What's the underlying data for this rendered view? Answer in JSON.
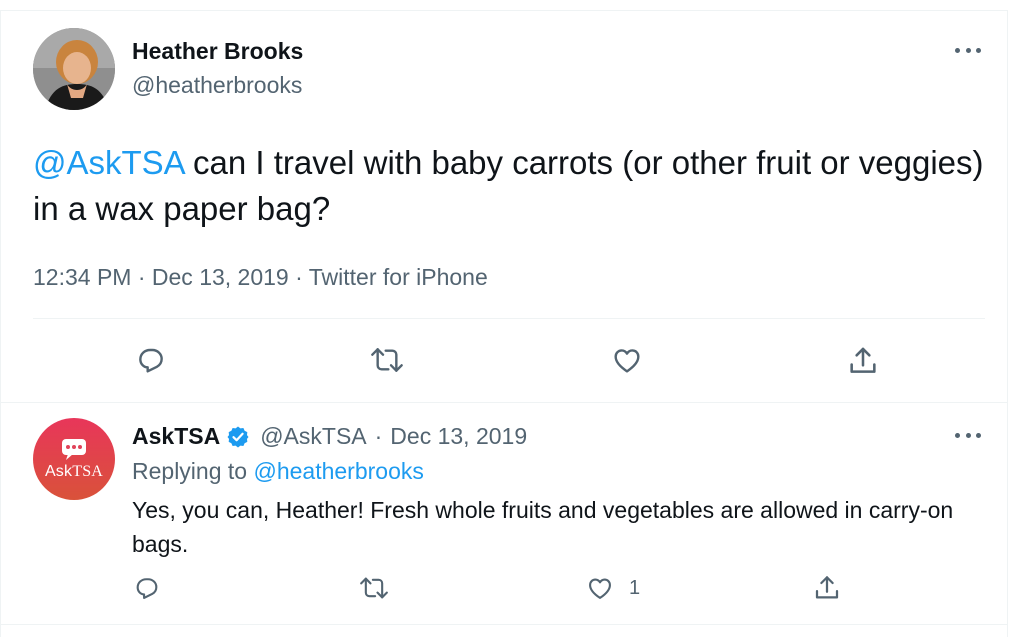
{
  "tweet": {
    "author_name": "Heather Brooks",
    "author_handle": "@heatherbrooks",
    "mention": "@AskTSA",
    "text": " can I travel with baby carrots (or other fruit or veggies) in a wax paper bag?",
    "time": "12:34 PM",
    "date": "Dec 13, 2019",
    "source": "Twitter for iPhone",
    "separator": "·"
  },
  "reply": {
    "author_name": "AskTSA",
    "author_handle": "@AskTSA",
    "separator": "·",
    "date": "Dec 13, 2019",
    "replying_label": "Replying to",
    "replying_to": "@heatherbrooks",
    "text": "Yes, you can, Heather! Fresh whole fruits and vegetables are allowed in carry-on bags.",
    "like_count": "1",
    "avatar_text_a": "Ask",
    "avatar_text_b": "TSA"
  },
  "icons": {
    "reply": "reply-icon",
    "retweet": "retweet-icon",
    "like": "heart-icon",
    "share": "share-icon",
    "more": "more-icon",
    "verified": "verified-icon"
  },
  "colors": {
    "link": "#1d9bf0",
    "muted": "#536471",
    "verified": "#1d9bf0",
    "asktsa_avatar_top": "#e8365a",
    "asktsa_avatar_bottom": "#d9523a"
  }
}
